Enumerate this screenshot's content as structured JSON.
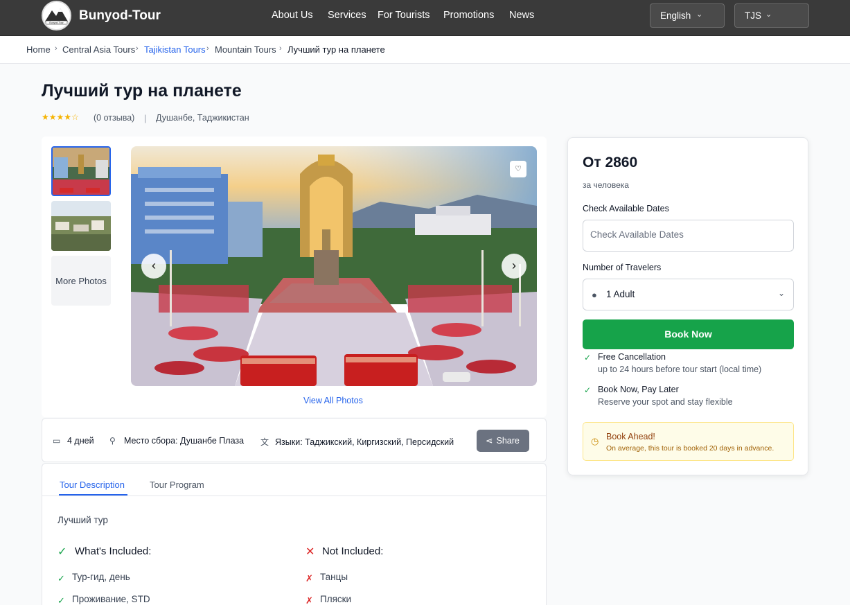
{
  "header": {
    "brand": "Bunyod-Tour",
    "nav": [
      "About Us",
      "Services",
      "For Tourists",
      "Promotions",
      "News"
    ],
    "language": "English",
    "currency": "TJS"
  },
  "breadcrumb": [
    "Home",
    "Central Asia Tours",
    "Tajikistan Tours",
    "Mountain Tours",
    "Лучший тур на планете"
  ],
  "tour": {
    "title": "Лучший тур на планете",
    "rating_stars": "★★★★☆",
    "reviews": "(0 отзыва)",
    "location": "Душанбе, Таджикистан"
  },
  "gallery": {
    "more_photos": "More Photos",
    "view_all": "View All Photos"
  },
  "info": {
    "duration": "4 дней",
    "meeting": "Место сбора: Душанбе Плаза",
    "languages": "Языки: Таджикский, Киргизский, Персидский",
    "share": "Share"
  },
  "tabs": [
    "Tour Description",
    "Tour Program"
  ],
  "description": "Лучший тур",
  "included": {
    "title": "What's Included:",
    "items": [
      "Тур-гид, день",
      "Проживание, STD"
    ]
  },
  "not_included": {
    "title": "Not Included:",
    "items": [
      "Танцы",
      "Пляски"
    ]
  },
  "booking": {
    "price": "От 2860",
    "per_person": "за человека",
    "dates_label": "Check Available Dates",
    "dates_placeholder": "Check Available Dates",
    "travelers_label": "Number of Travelers",
    "travelers_value": "1 Adult",
    "book_button": "Book Now",
    "perks": [
      {
        "title": "Free Cancellation",
        "subtitle": "up to 24 hours before tour start (local time)"
      },
      {
        "title": "Book Now, Pay Later",
        "subtitle": "Reserve your spot and stay flexible"
      }
    ],
    "ahead_title": "Book Ahead!",
    "ahead_text": "On average, this tour is booked 20 days in advance."
  },
  "colors": {
    "header_bg": "#3a3a3a",
    "accent_blue": "#2563eb",
    "book_green": "#16a34a",
    "star_gold": "#f5b301"
  }
}
